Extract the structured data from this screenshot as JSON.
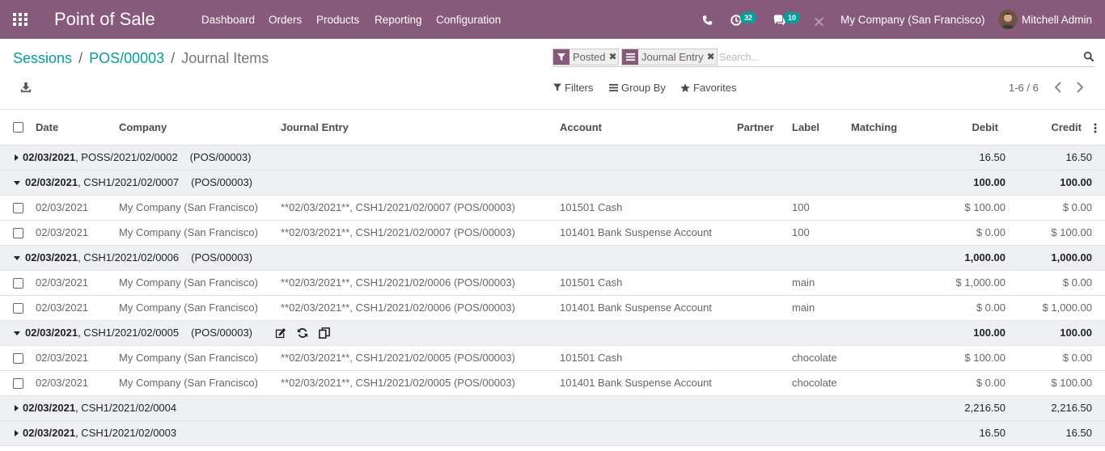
{
  "navbar": {
    "app_title": "Point of Sale",
    "menus": [
      "Dashboard",
      "Orders",
      "Products",
      "Reporting",
      "Configuration"
    ],
    "activity_count": "32",
    "messages_count": "10",
    "company": "My Company (San Francisco)",
    "user": "Mitchell Admin",
    "icons": [
      "apps-icon",
      "phone-icon",
      "clock-icon",
      "chat-icon",
      "wrench-icon"
    ],
    "brand_color": "#875a7b",
    "badge_color": "#00a09d"
  },
  "breadcrumb": {
    "items": [
      "Sessions",
      "POS/00003"
    ],
    "separator": "/",
    "current": "Journal Items",
    "link_color": "#00a09d"
  },
  "search": {
    "facets": [
      {
        "value": "Posted",
        "icon": "filter-icon"
      },
      {
        "value": "Journal Entry",
        "icon": "list-icon"
      }
    ],
    "placeholder": "Search..."
  },
  "panel": {
    "filters": "Filters",
    "group_by": "Group By",
    "favorites": "Favorites",
    "pager": "1-6 / 6"
  },
  "table": {
    "columns": [
      "Date",
      "Company",
      "Journal Entry",
      "Account",
      "Partner",
      "Label",
      "Matching",
      "Debit",
      "Credit"
    ],
    "groups": [
      {
        "date": "02/03/2021",
        "ref": ", POSS/2021/02/0002",
        "session": "(POS/00003)",
        "expanded": false,
        "debit": "16.50",
        "credit": "16.50",
        "bold_totals": false
      },
      {
        "date": "02/03/2021",
        "ref": ", CSH1/2021/02/0007",
        "session": "(POS/00003)",
        "expanded": true,
        "debit": "100.00",
        "credit": "100.00",
        "bold_totals": true,
        "rows": [
          {
            "date": "02/03/2021",
            "company": "My Company (San Francisco)",
            "entry": "**02/03/2021**, CSH1/2021/02/0007 (POS/00003)",
            "account": "101501 Cash",
            "label": "100",
            "debit": "$ 100.00",
            "credit": "$ 0.00"
          },
          {
            "date": "02/03/2021",
            "company": "My Company (San Francisco)",
            "entry": "**02/03/2021**, CSH1/2021/02/0007 (POS/00003)",
            "account": "101401 Bank Suspense Account",
            "label": "100",
            "debit": "$ 0.00",
            "credit": "$ 100.00"
          }
        ]
      },
      {
        "date": "02/03/2021",
        "ref": ", CSH1/2021/02/0006",
        "session": "(POS/00003)",
        "expanded": true,
        "debit": "1,000.00",
        "credit": "1,000.00",
        "bold_totals": true,
        "rows": [
          {
            "date": "02/03/2021",
            "company": "My Company (San Francisco)",
            "entry": "**02/03/2021**, CSH1/2021/02/0006 (POS/00003)",
            "account": "101501 Cash",
            "label": "main",
            "debit": "$ 1,000.00",
            "credit": "$ 0.00"
          },
          {
            "date": "02/03/2021",
            "company": "My Company (San Francisco)",
            "entry": "**02/03/2021**, CSH1/2021/02/0006 (POS/00003)",
            "account": "101401 Bank Suspense Account",
            "label": "main",
            "debit": "$ 0.00",
            "credit": "$ 1,000.00"
          }
        ]
      },
      {
        "date": "02/03/2021",
        "ref": ", CSH1/2021/02/0005",
        "session": "(POS/00003)",
        "expanded": true,
        "debit": "100.00",
        "credit": "100.00",
        "bold_totals": true,
        "actions": [
          "edit-icon",
          "refresh-icon",
          "copy-icon"
        ],
        "rows": [
          {
            "date": "02/03/2021",
            "company": "My Company (San Francisco)",
            "entry": "**02/03/2021**, CSH1/2021/02/0005 (POS/00003)",
            "account": "101501 Cash",
            "label": "chocolate",
            "debit": "$ 100.00",
            "credit": "$ 0.00"
          },
          {
            "date": "02/03/2021",
            "company": "My Company (San Francisco)",
            "entry": "**02/03/2021**, CSH1/2021/02/0005 (POS/00003)",
            "account": "101401 Bank Suspense Account",
            "label": "chocolate",
            "debit": "$ 0.00",
            "credit": "$ 100.00"
          }
        ]
      },
      {
        "date": "02/03/2021",
        "ref": ", CSH1/2021/02/0004",
        "session": "",
        "expanded": false,
        "debit": "2,216.50",
        "credit": "2,216.50",
        "bold_totals": false
      },
      {
        "date": "02/03/2021",
        "ref": ", CSH1/2021/02/0003",
        "session": "",
        "expanded": false,
        "debit": "16.50",
        "credit": "16.50",
        "bold_totals": false
      }
    ]
  }
}
